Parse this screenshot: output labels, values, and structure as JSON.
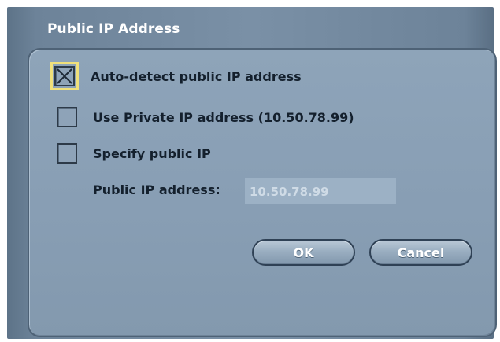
{
  "dialog": {
    "title": "Public IP Address"
  },
  "options": [
    {
      "label": "Auto-detect public IP address",
      "checked": true
    },
    {
      "label": "Use Private IP address (10.50.78.99)",
      "checked": false
    },
    {
      "label": "Specify public IP",
      "checked": false
    }
  ],
  "public_ip": {
    "label": "Public IP address:",
    "value": "10.50.78.99"
  },
  "buttons": {
    "ok_label": "OK",
    "cancel_label": "Cancel"
  },
  "colors": {
    "panel": "#889eb4",
    "border": "#4e6276",
    "focus": "#f0e07a"
  }
}
